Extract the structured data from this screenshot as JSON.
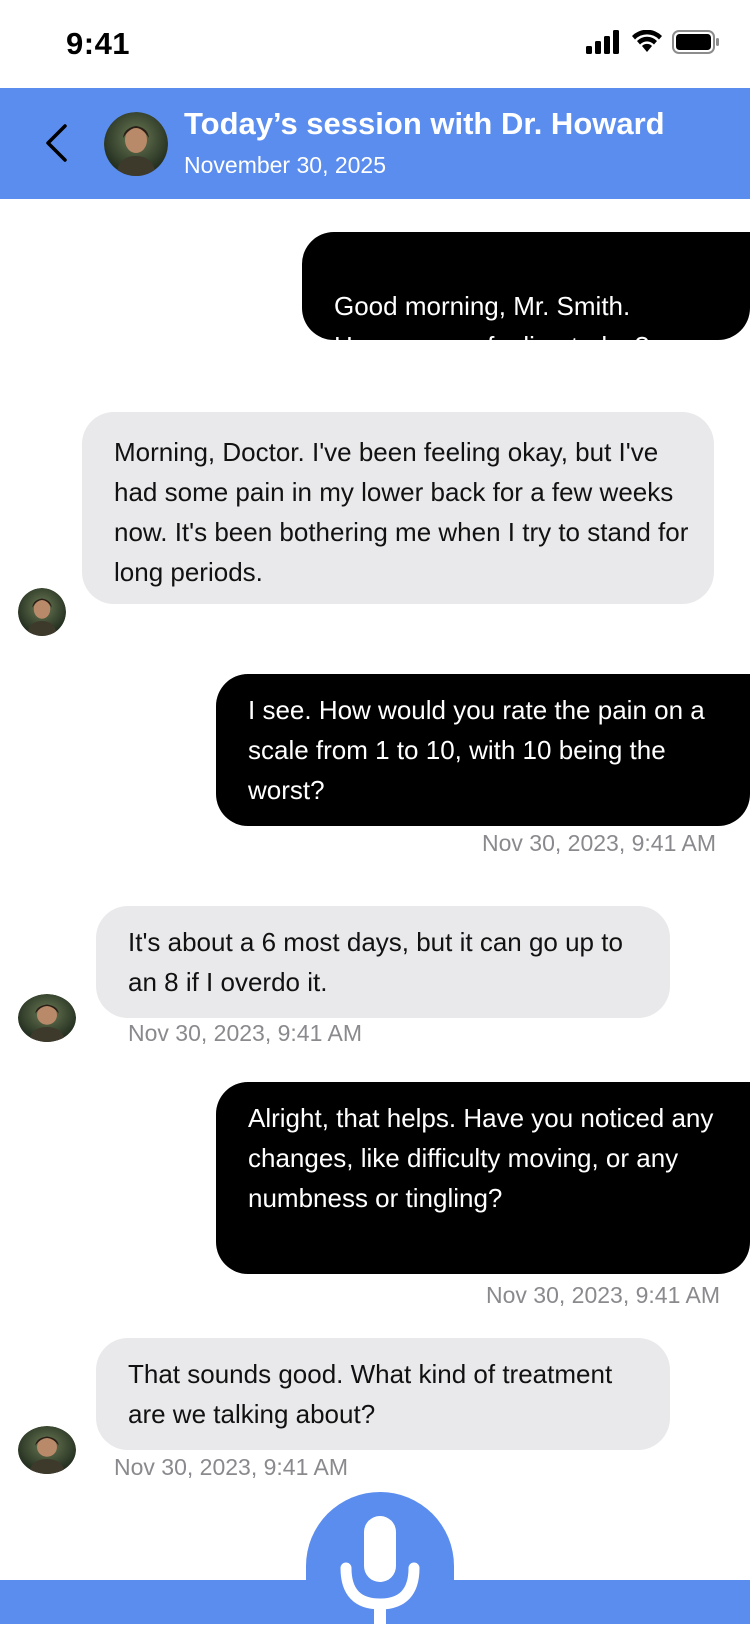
{
  "status": {
    "time": "9:41"
  },
  "header": {
    "title": "Today’s session with Dr. Howard",
    "date": "November 30, 2025"
  },
  "messages": [
    {
      "from": "doctor",
      "text": "Good morning, Mr. Smith.\nHow are you feeling today?",
      "timestamp": ""
    },
    {
      "from": "patient",
      "text": "Morning, Doctor. I've been feeling okay, but I've had some pain in my lower back for a few weeks now. It's been bothering me when I try to stand for long periods.",
      "timestamp": ""
    },
    {
      "from": "doctor",
      "text": "I see. How would you rate the pain on a scale from 1 to 10, with 10 being the worst?",
      "timestamp": "Nov 30, 2023, 9:41 AM"
    },
    {
      "from": "patient",
      "text": "It's about a 6 most days, but it can go up to an 8 if I overdo it.",
      "timestamp": "Nov 30, 2023, 9:41 AM"
    },
    {
      "from": "doctor",
      "text": "Alright, that helps. Have you noticed any changes, like difficulty moving, or any numbness or tingling?",
      "timestamp": "Nov 30, 2023, 9:41 AM"
    },
    {
      "from": "patient",
      "text": "That sounds good. What kind of treatment are we talking about?",
      "timestamp": "Nov 30, 2023, 9:41 AM"
    }
  ],
  "icons": {
    "back": "chevron-left-icon",
    "mic": "microphone-icon",
    "signal": "cellular-signal-icon",
    "wifi": "wifi-icon",
    "battery": "battery-icon"
  },
  "colors": {
    "accent": "#5b8def",
    "outgoing_bubble": "#000000",
    "incoming_bubble": "#e9e9eb",
    "timestamp": "#8a8a8e"
  }
}
